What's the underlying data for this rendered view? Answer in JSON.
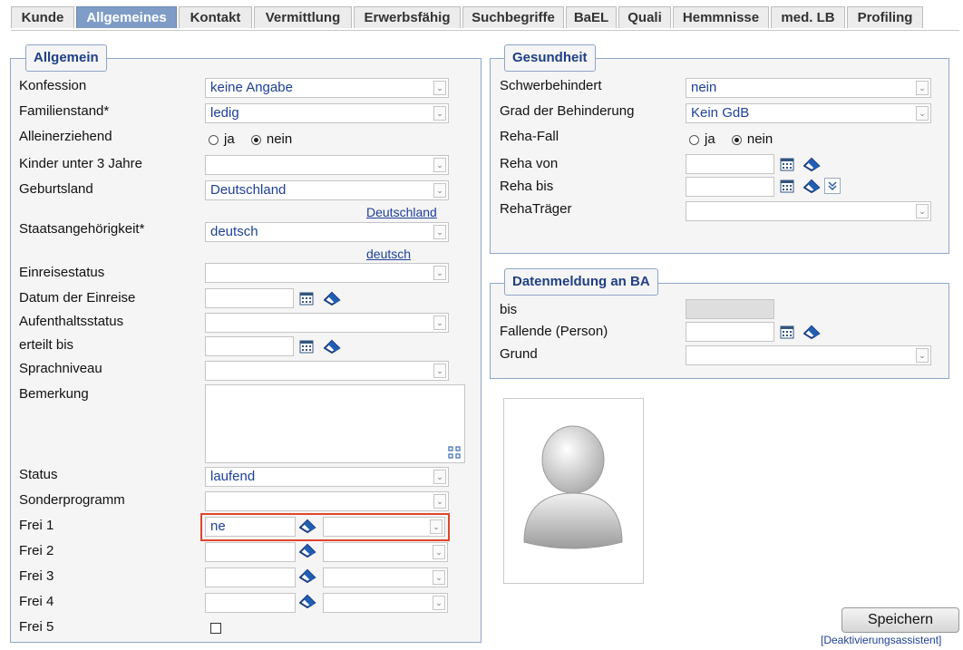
{
  "tabs": [
    "Kunde",
    "Allgemeines",
    "Kontakt",
    "Vermittlung",
    "Erwerbsfähig",
    "Suchbegriffe",
    "BaEL",
    "Quali",
    "Hemmnisse",
    "med. LB",
    "Profiling"
  ],
  "active_tab": "Allgemeines",
  "allgemein": {
    "legend": "Allgemein",
    "konfession": {
      "label": "Konfession",
      "value": "keine Angabe"
    },
    "familienstand": {
      "label": "Familienstand*",
      "value": "ledig"
    },
    "alleinerziehend": {
      "label": "Alleinerziehend",
      "opt_ja": "ja",
      "opt_nein": "nein",
      "selected": "nein"
    },
    "kinder": {
      "label": "Kinder unter 3 Jahre",
      "value": ""
    },
    "geburtsland": {
      "label": "Geburtsland",
      "value": "Deutschland",
      "link": "Deutschland"
    },
    "staat": {
      "label": "Staatsangehörigkeit*",
      "value": "deutsch",
      "link": "deutsch"
    },
    "einreisestatus": {
      "label": "Einreisestatus",
      "value": ""
    },
    "datum_einreise": {
      "label": "Datum der Einreise",
      "value": ""
    },
    "aufenthaltsstatus": {
      "label": "Aufenthaltsstatus",
      "value": ""
    },
    "erteilt_bis": {
      "label": "erteilt bis",
      "value": ""
    },
    "sprachniveau": {
      "label": "Sprachniveau",
      "value": ""
    },
    "bemerkung": {
      "label": "Bemerkung",
      "value": ""
    },
    "status": {
      "label": "Status",
      "value": "laufend"
    },
    "sonderprogramm": {
      "label": "Sonderprogramm",
      "value": ""
    },
    "frei1": {
      "label": "Frei 1",
      "value": "ne"
    },
    "frei2": {
      "label": "Frei 2",
      "value": ""
    },
    "frei3": {
      "label": "Frei 3",
      "value": ""
    },
    "frei4": {
      "label": "Frei 4",
      "value": ""
    },
    "frei5": {
      "label": "Frei 5",
      "checked": false
    }
  },
  "gesundheit": {
    "legend": "Gesundheit",
    "schwerbehindert": {
      "label": "Schwerbehindert",
      "value": "nein"
    },
    "grad": {
      "label": "Grad der Behinderung",
      "value": "Kein GdB"
    },
    "reha_fall": {
      "label": "Reha-Fall",
      "opt_ja": "ja",
      "opt_nein": "nein",
      "selected": "nein"
    },
    "reha_von": {
      "label": "Reha von",
      "value": ""
    },
    "reha_bis": {
      "label": "Reha bis",
      "value": ""
    },
    "reha_traeger": {
      "label": "RehaTräger",
      "value": ""
    }
  },
  "datenmeldung": {
    "legend": "Datenmeldung an BA",
    "bis": {
      "label": "bis",
      "value": ""
    },
    "fallende": {
      "label": "Fallende (Person)",
      "value": ""
    },
    "grund": {
      "label": "Grund",
      "value": ""
    }
  },
  "actions": {
    "save": "Speichern",
    "deactivate": "[Deaktivierungsassistent]"
  },
  "colors": {
    "accent": "#7f9cc7",
    "legend_text": "#1f3f85",
    "value_text": "#1e3f9a",
    "highlight": "#e0452e"
  },
  "icons": [
    "calendar-icon",
    "eraser-icon",
    "expand-icon",
    "resize-icon",
    "user-avatar-icon"
  ]
}
